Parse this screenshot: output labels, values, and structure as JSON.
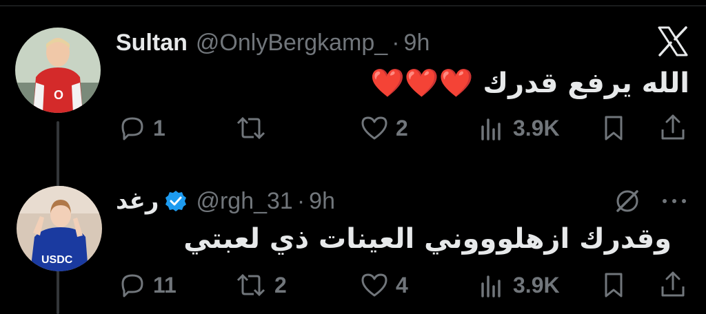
{
  "tweets": [
    {
      "display_name": "Sultan",
      "handle": "@OnlyBergkamp_",
      "separator": "·",
      "time": "9h",
      "text": "الله يرفع قدرك ❤️❤️❤️",
      "actions": {
        "replies": "1",
        "retweets": "",
        "likes": "2",
        "views": "3.9K"
      }
    },
    {
      "display_name": "رغد",
      "handle": "@rgh_31",
      "separator": "·",
      "time": "9h",
      "verified": true,
      "text": "وقدرك ازهلوووني العينات ذي لعبتي",
      "actions": {
        "replies": "11",
        "retweets": "2",
        "likes": "4",
        "views": "3.9K"
      }
    }
  ],
  "colors": {
    "background": "#000000",
    "text": "#e7e9ea",
    "muted": "#71767b",
    "verified": "#1d9bf0",
    "heart": "#e8323c"
  },
  "icons": [
    "x-logo-icon",
    "reply-icon",
    "retweet-icon",
    "like-icon",
    "views-icon",
    "bookmark-icon",
    "share-icon",
    "grok-icon",
    "more-icon",
    "verified-badge-icon"
  ]
}
